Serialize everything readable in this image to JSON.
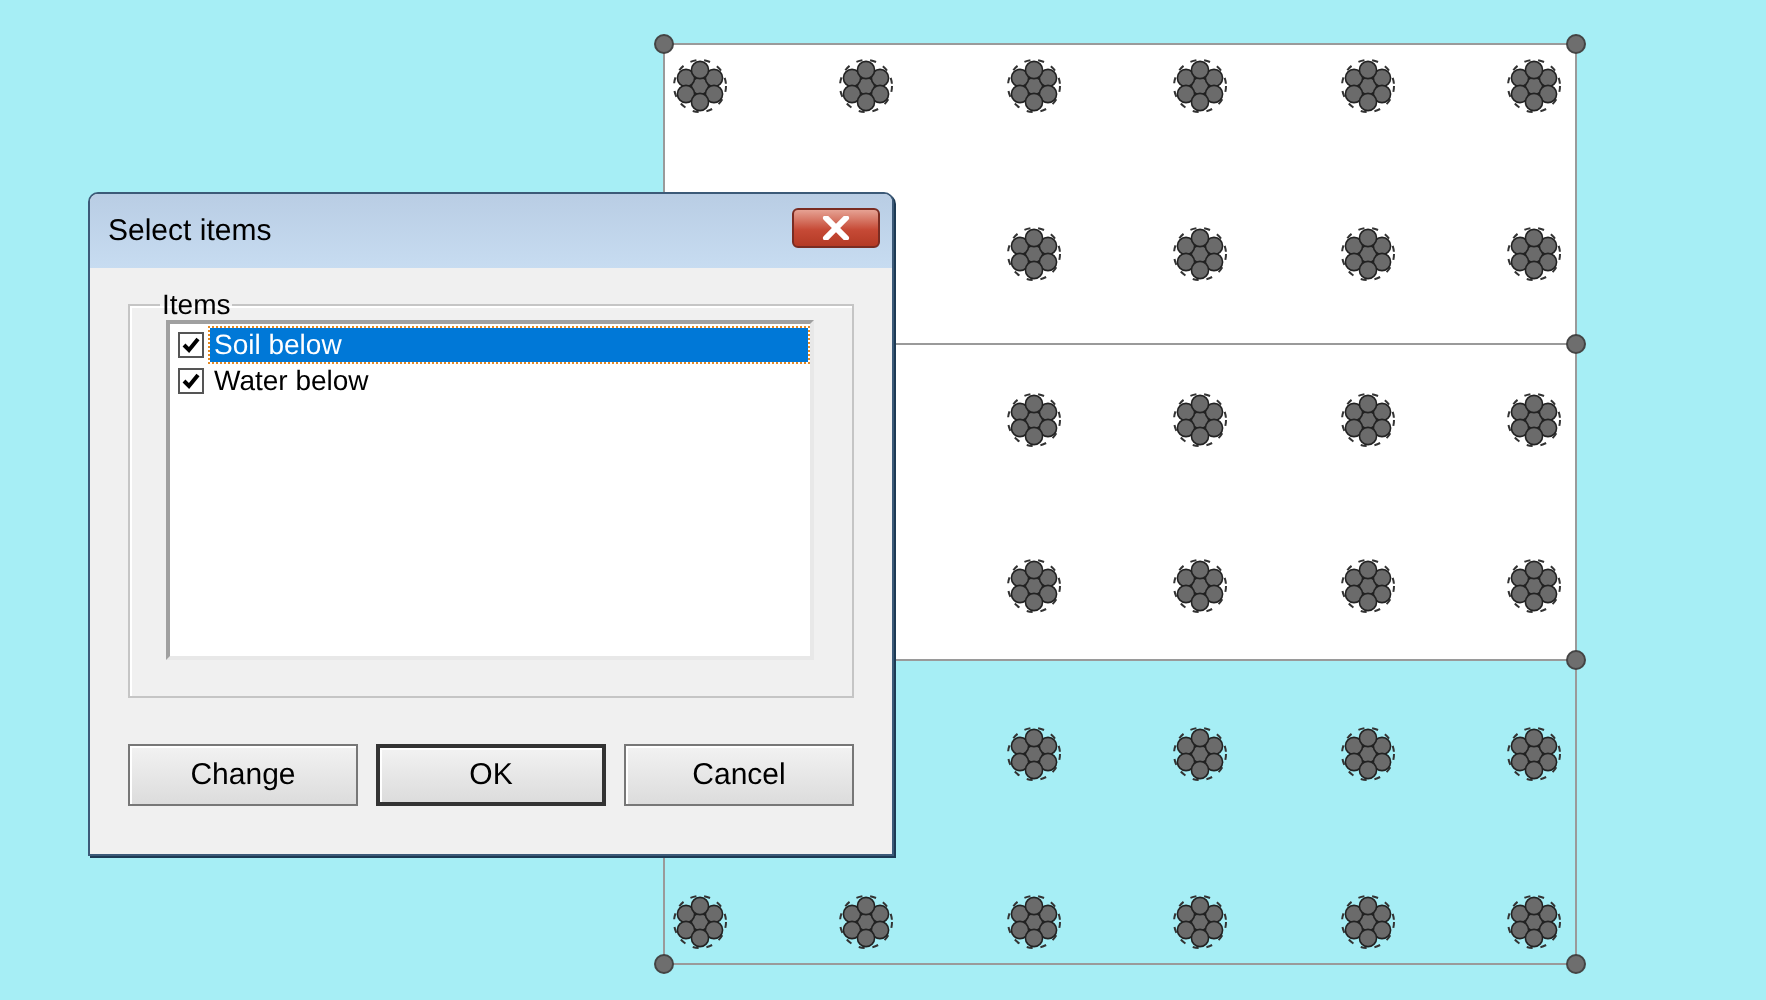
{
  "dialog": {
    "title": "Select items",
    "group_label": "Items",
    "items": [
      {
        "label": "Soil below",
        "checked": true,
        "selected": true
      },
      {
        "label": "Water below",
        "checked": true,
        "selected": false
      }
    ],
    "buttons": [
      {
        "label": "Change",
        "default": false
      },
      {
        "label": "OK",
        "default": true
      },
      {
        "label": "Cancel",
        "default": false
      }
    ]
  },
  "diagram": {
    "regions": [
      {
        "color": "#ffffff"
      },
      {
        "color": "#ffffff"
      },
      {
        "color": "#a6eef5"
      }
    ]
  }
}
